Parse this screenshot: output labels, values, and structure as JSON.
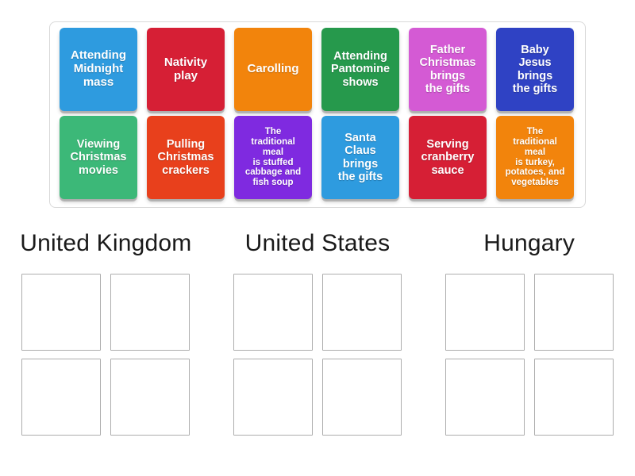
{
  "activity": {
    "type": "group-sort",
    "tile_bank": {
      "rows": [
        [
          {
            "label": "Attending\nMidnight\nmass",
            "color": "#2e9bdf",
            "size": "lg"
          },
          {
            "label": "Nativity\nplay",
            "color": "#d61f35",
            "size": "lg"
          },
          {
            "label": "Carolling",
            "color": "#f2840c",
            "size": "lg"
          },
          {
            "label": "Attending\nPantomine\nshows",
            "color": "#26994c",
            "size": "md"
          },
          {
            "label": "Father\nChristmas\nbrings\nthe gifts",
            "color": "#d45ad4",
            "size": "md"
          },
          {
            "label": "Baby\nJesus\nbrings\nthe gifts",
            "color": "#2f42c4",
            "size": "md"
          }
        ],
        [
          {
            "label": "Viewing\nChristmas\nmovies",
            "color": "#3cb878",
            "size": "md"
          },
          {
            "label": "Pulling\nChristmas\ncrackers",
            "color": "#e8401c",
            "size": "md"
          },
          {
            "label": "The\ntraditional\nmeal\nis stuffed\ncabbage and\nfish soup",
            "color": "#7f2ae0",
            "size": "sm"
          },
          {
            "label": "Santa\nClaus\nbrings\nthe gifts",
            "color": "#2e9bdf",
            "size": "md"
          },
          {
            "label": "Serving\ncranberry\nsauce",
            "color": "#d61f35",
            "size": "md"
          },
          {
            "label": "The\ntraditional\nmeal\nis turkey,\npotatoes, and\nvegetables",
            "color": "#f2840c",
            "size": "sm"
          }
        ]
      ]
    },
    "categories": [
      {
        "title": "United Kingdom",
        "slots": [
          "",
          "",
          "",
          ""
        ]
      },
      {
        "title": "United States",
        "slots": [
          "",
          "",
          "",
          ""
        ]
      },
      {
        "title": "Hungary",
        "slots": [
          "",
          "",
          "",
          ""
        ]
      }
    ],
    "colors": {
      "panel_border": "#d9d9d9",
      "slot_border": "#adadad",
      "background": "#ffffff",
      "heading_text": "#1a1a1a",
      "tile_text": "#ffffff"
    }
  }
}
